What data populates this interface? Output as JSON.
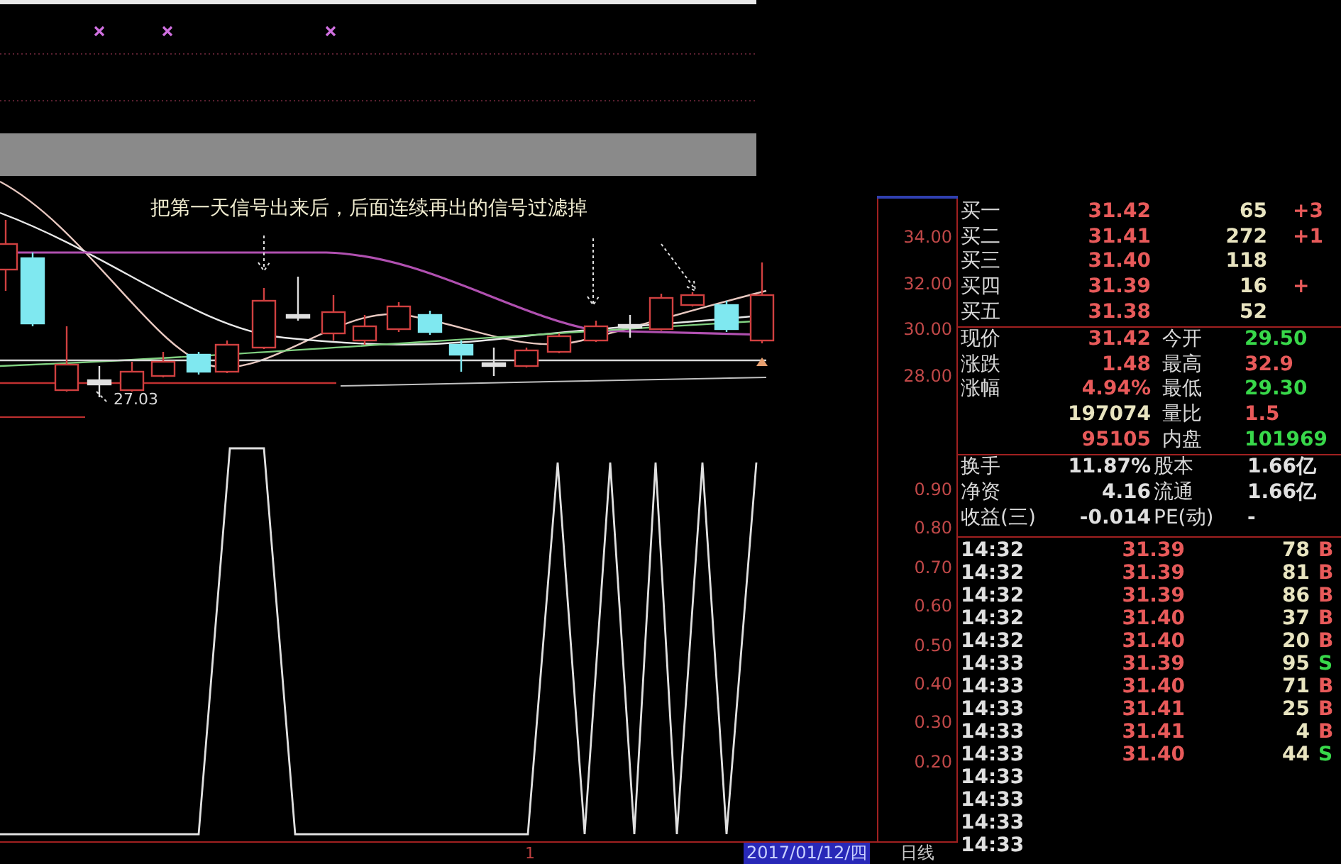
{
  "price_chart": {
    "annotation": "把第一天信号出来后，后面连续再出的信号过滤掉",
    "low_label": "27.03",
    "axis_labels": [
      "34.00",
      "32.00",
      "30.00",
      "28.00"
    ]
  },
  "indicator_chart": {
    "axis_labels": [
      "0.90",
      "0.80",
      "0.70",
      "0.60",
      "0.50",
      "0.40",
      "0.30",
      "0.20"
    ]
  },
  "time_axis": {
    "tick_label": "1",
    "cursor_date": "2017/01/12/四",
    "period": "日线"
  },
  "order_book": [
    {
      "label": "买一",
      "price": "31.42",
      "volume": "65",
      "change": "+3"
    },
    {
      "label": "买二",
      "price": "31.41",
      "volume": "272",
      "change": "+1"
    },
    {
      "label": "买三",
      "price": "31.40",
      "volume": "118"
    },
    {
      "label": "买四",
      "price": "31.39",
      "volume": "16",
      "change": "+"
    },
    {
      "label": "买五",
      "price": "31.38",
      "volume": "52"
    }
  ],
  "quote": [
    {
      "cells": [
        {
          "label": "现价",
          "value": "31.42",
          "color": "#e85a5a"
        },
        {
          "label": "今开",
          "value": "29.50",
          "color": "#38d84a"
        }
      ]
    },
    {
      "cells": [
        {
          "label": "涨跌",
          "value": "1.48",
          "color": "#e85a5a"
        },
        {
          "label": "最高",
          "value": "32.9",
          "color": "#e85a5a"
        }
      ]
    },
    {
      "cells": [
        {
          "label": "涨幅",
          "value": "4.94%",
          "color": "#e85a5a"
        },
        {
          "label": "最低",
          "value": "29.30",
          "color": "#38d84a"
        }
      ]
    },
    {
      "cells": [
        {
          "value": "197074",
          "color": "#e8e4c0"
        },
        {
          "label": "量比",
          "value": "1.5",
          "color": "#e85a5a"
        }
      ]
    },
    {
      "cells": [
        {
          "value": "95105",
          "color": "#e85a5a"
        },
        {
          "label": "内盘",
          "value": "101969",
          "color": "#38d84a"
        }
      ]
    }
  ],
  "fundamentals": [
    {
      "label": "换手",
      "value": "11.87%",
      "label_2": "股本",
      "value_2": "1.66亿"
    },
    {
      "label": "净资",
      "value": "4.16",
      "label_2": "流通",
      "value_2": "1.66亿"
    },
    {
      "label": "收益(三)",
      "value": "-0.014",
      "label_2": "PE(动)",
      "value_2": "-"
    }
  ],
  "ticks": [
    {
      "time": "14:32",
      "price": "31.39",
      "volume": "78",
      "side": "B",
      "color": "#e85a5a"
    },
    {
      "time": "14:32",
      "price": "31.39",
      "volume": "81",
      "side": "B",
      "color": "#e85a5a"
    },
    {
      "time": "14:32",
      "price": "31.39",
      "volume": "86",
      "side": "B",
      "color": "#e85a5a"
    },
    {
      "time": "14:32",
      "price": "31.40",
      "volume": "37",
      "side": "B",
      "color": "#e85a5a"
    },
    {
      "time": "14:32",
      "price": "31.40",
      "volume": "20",
      "side": "B",
      "color": "#e85a5a"
    },
    {
      "time": "14:33",
      "price": "31.39",
      "volume": "95",
      "side": "S",
      "color": "#38d84a"
    },
    {
      "time": "14:33",
      "price": "31.40",
      "volume": "71",
      "side": "B",
      "color": "#e85a5a"
    },
    {
      "time": "14:33",
      "price": "31.41",
      "volume": "25",
      "side": "B",
      "color": "#e85a5a"
    },
    {
      "time": "14:33",
      "price": "31.41",
      "volume": "4",
      "side": "B",
      "color": "#e85a5a"
    },
    {
      "time": "14:33",
      "price": "31.40",
      "volume": "44",
      "side": "S",
      "color": "#38d84a"
    },
    {
      "time": "14:33"
    },
    {
      "time": "14:33"
    },
    {
      "time": "14:33"
    },
    {
      "time": "14:33"
    }
  ]
}
